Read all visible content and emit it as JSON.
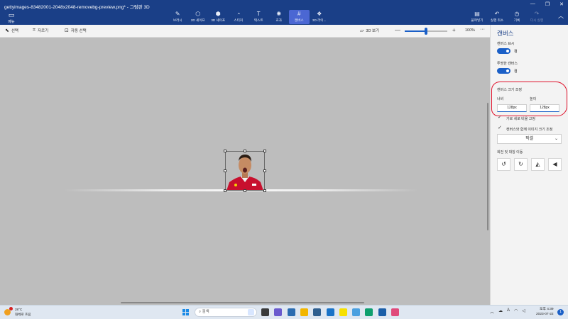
{
  "window": {
    "title": "gettyimages-83482001-2048x2048-removebg-preview.png* - 그림판 3D",
    "controls": [
      "—",
      "❐",
      "✕"
    ]
  },
  "ribbon": {
    "menu_label": "메뉴",
    "tools": [
      {
        "label": "브러시",
        "icon": "brush-icon",
        "glyph": "✎"
      },
      {
        "label": "2D 셰이프",
        "icon": "shape-2d-icon",
        "glyph": "⬡"
      },
      {
        "label": "3D 셰이프",
        "icon": "shape-3d-icon",
        "glyph": "⬢"
      },
      {
        "label": "스티커",
        "icon": "sticker-icon",
        "glyph": "◔"
      },
      {
        "label": "텍스트",
        "icon": "text-icon",
        "glyph": "T"
      },
      {
        "label": "효과",
        "icon": "effects-icon",
        "glyph": "✺"
      },
      {
        "label": "캔버스",
        "icon": "canvas-icon",
        "glyph": "#",
        "active": true
      },
      {
        "label": "3D 라이...",
        "icon": "library-3d-icon",
        "glyph": "❖"
      }
    ],
    "right_actions": [
      {
        "label": "붙여넣기",
        "icon": "paste-icon",
        "glyph": "📋"
      },
      {
        "label": "실행 취소",
        "icon": "undo-icon",
        "glyph": "↶"
      },
      {
        "label": "기록",
        "icon": "history-icon",
        "glyph": "◷"
      },
      {
        "label": "다시 실행",
        "icon": "redo-icon",
        "glyph": "↷",
        "disabled": true
      }
    ]
  },
  "toolbar": {
    "select_label": "선택",
    "crop_label": "자르기",
    "magic_select_label": "자동 선택",
    "view3d_label": "3D 보기",
    "zoom_percent": "100%",
    "zoom_level": 0.5,
    "more_glyph": "···"
  },
  "panel": {
    "title": "캔버스",
    "show_canvas_label": "캔버스 표시",
    "show_canvas_state": "켬",
    "transparent_canvas_label": "투명한 캔버스",
    "transparent_canvas_state": "켬",
    "resize_label": "캔버스 크기 조정",
    "width_label": "너비",
    "height_label": "높이",
    "width_value": "128px",
    "height_value": "128px",
    "lock_aspect_label": "가로 세로 비율 고정",
    "resize_image_label": "캔버스와 함께 이미지 크기 조정",
    "unit_selected": "픽셀",
    "rotate_flip_label": "회전 및 대칭 이동",
    "rotate_buttons": [
      {
        "icon": "rotate-left-icon",
        "glyph": "↺"
      },
      {
        "icon": "rotate-right-icon",
        "glyph": "↻"
      },
      {
        "icon": "flip-horizontal-icon",
        "glyph": "◭"
      },
      {
        "icon": "flip-vertical-icon",
        "glyph": "◀"
      }
    ]
  },
  "taskbar": {
    "weather_temp": "28°C",
    "weather_desc": "대체로 흐림",
    "search_placeholder": "검색",
    "time": "오후 4:39",
    "date": "2023-07-22",
    "notification_count": "1",
    "apps": [
      {
        "icon": "task-view-icon",
        "color": "#3a3a3a"
      },
      {
        "icon": "chat-icon",
        "color": "#6a5acd"
      },
      {
        "icon": "widgets-icon",
        "color": "#2b6cb0"
      },
      {
        "icon": "file-explorer-icon",
        "color": "#f2b600"
      },
      {
        "icon": "calculator-icon",
        "color": "#2f5f8f"
      },
      {
        "icon": "mail-icon",
        "color": "#1a73c7"
      },
      {
        "icon": "kakaotalk-icon",
        "color": "#f7e000"
      },
      {
        "icon": "notepad-icon",
        "color": "#4aa0e0"
      },
      {
        "icon": "edge-icon",
        "color": "#0e9f6e"
      },
      {
        "icon": "photos-icon",
        "color": "#1b5fa8"
      },
      {
        "icon": "paint3d-icon",
        "color": "#e04a7a"
      }
    ]
  },
  "colors": {
    "ribbon": "#1a3f87",
    "accent": "#1a5fc7",
    "canvas_bg": "#bdbdbd",
    "annotation": "#e0102a"
  }
}
